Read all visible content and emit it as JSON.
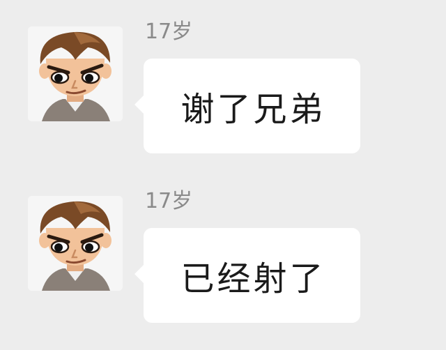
{
  "messages": [
    {
      "sender": "17岁",
      "text": "谢了兄弟",
      "avatar_icon": "cartoon-boy-avatar-icon"
    },
    {
      "sender": "17岁",
      "text": "已经射了",
      "avatar_icon": "cartoon-boy-avatar-icon"
    }
  ],
  "colors": {
    "background": "#ededed",
    "bubble": "#ffffff",
    "sender_text": "#8a8a8a",
    "message_text": "#1a1a1a",
    "hair": "#7a4a26",
    "skin": "#f2c29a",
    "shirt": "#8a8078"
  }
}
